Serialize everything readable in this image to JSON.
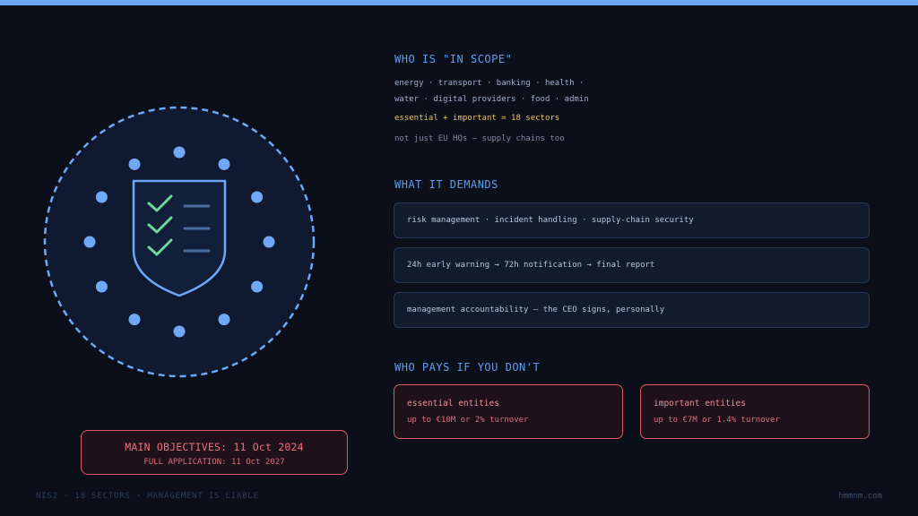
{
  "colors": {
    "accent": "#6ea8f7",
    "background": "#0b0f19",
    "highlight": "#f0c45c",
    "warning": "#d9596b",
    "check": "#6fd69a"
  },
  "emblem": {
    "icon": "shield-checklist-icon",
    "dot_count": 12
  },
  "deadline": {
    "main": "MAIN OBJECTIVES: 11 Oct 2024",
    "sub": "FULL APPLICATION: 11 Oct 2027"
  },
  "scope": {
    "title": "WHO IS \"IN SCOPE\"",
    "line1": "energy · transport · banking · health ·",
    "line2": "water · digital providers · food · admin",
    "highlight": "essential + important = 18 sectors",
    "note": "not just EU HQs — supply chains too"
  },
  "demands": {
    "title": "WHAT IT DEMANDS",
    "items": [
      "risk management · incident handling · supply-chain security",
      "24h early warning → 72h notification → final report",
      "management accountability — the CEO signs, personally"
    ]
  },
  "penalties": {
    "title": "WHO PAYS IF YOU DON'T",
    "essential": {
      "label": "essential entities",
      "value": "up to €10M or 2% turnover"
    },
    "important": {
      "label": "important entities",
      "value": "up to €7M or 1.4% turnover"
    }
  },
  "footer": {
    "left": "NIS2 · 18 SECTORS · MANAGEMENT IS LIABLE",
    "right": "hmmnm.com"
  }
}
